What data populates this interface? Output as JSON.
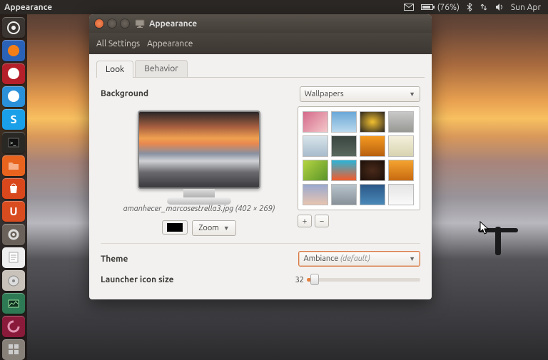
{
  "panel": {
    "app_title": "Appearance",
    "battery": "(76%)",
    "clock": "Sun Apr"
  },
  "launcher": {
    "items": [
      {
        "name": "dash",
        "bg": "#3a3530",
        "inner": "#efefef",
        "shape": "dash"
      },
      {
        "name": "firefox",
        "bg": "#2a62b8",
        "inner": "#f57f17",
        "shape": "circle"
      },
      {
        "name": "opera",
        "bg": "#b41f2a",
        "inner": "#fff",
        "shape": "circle"
      },
      {
        "name": "chromium",
        "bg": "#2a90d9",
        "inner": "#fff",
        "shape": "circle"
      },
      {
        "name": "skype",
        "bg": "#1aa0e8",
        "inner": "#fff",
        "shape": "s"
      },
      {
        "name": "terminal",
        "bg": "#2a2824",
        "inner": "#eee",
        "shape": "term"
      },
      {
        "name": "files",
        "bg": "#e8641e",
        "inner": "#f7b089",
        "shape": "folder"
      },
      {
        "name": "software-center",
        "bg": "#d9481c",
        "inner": "#fff",
        "shape": "bag"
      },
      {
        "name": "ubuntu-one",
        "bg": "#d94c20",
        "inner": "#fff",
        "shape": "u"
      },
      {
        "name": "settings",
        "bg": "#6a625a",
        "inner": "#ddd",
        "shape": "gear"
      },
      {
        "name": "text-editor",
        "bg": "#efefef",
        "inner": "#888",
        "shape": "note"
      },
      {
        "name": "disks",
        "bg": "#c8c2ba",
        "inner": "#555",
        "shape": "disk"
      },
      {
        "name": "system-monitor",
        "bg": "#2e7a55",
        "inner": "#9be2a0",
        "shape": "monitor"
      },
      {
        "name": "devices",
        "bg": "#8a1a3a",
        "inner": "#e294b2",
        "shape": "swirl"
      },
      {
        "name": "workspace",
        "bg": "#878079",
        "inner": "#ccc",
        "shape": "workspace"
      }
    ]
  },
  "window": {
    "title": "Appearance",
    "breadcrumb_root": "All Settings",
    "breadcrumb_current": "Appearance",
    "tabs": {
      "look": "Look",
      "behavior": "Behavior"
    },
    "look": {
      "background_label": "Background",
      "source_dropdown": "Wallpapers",
      "preview_caption": "amanhecer_marcosestrella3.jpg (402 × 269)",
      "zoom_button": "Zoom",
      "theme_label": "Theme",
      "theme_value": "Ambiance",
      "theme_suffix": "(default)",
      "launcher_label": "Launcher icon size",
      "launcher_value": "32",
      "thumbs": [
        "linear-gradient(135deg,#d46a8a,#f4c8ca)",
        "linear-gradient(#6aa8d8,#bad8ec)",
        "radial-gradient(#f2c030,#2a2520)",
        "linear-gradient(#c8c8c8,#989894)",
        "linear-gradient(#d8e4ea,#a8bccc)",
        "linear-gradient(#3a4440,#5a6a60)",
        "linear-gradient(#f49a20,#b86010)",
        "linear-gradient(#f4f0dc,#d8d4b0)",
        "linear-gradient(135deg,#b4d442,#5a9428)",
        "linear-gradient(#2ab4d8,#f45a2a)",
        "radial-gradient(#4a2a1a,#1a0e08)",
        "linear-gradient(#f4a430,#c86a10)",
        "linear-gradient(#9aa8d0,#e8c4b0)",
        "linear-gradient(#b8c4cc,#889098)",
        "linear-gradient(#2a5888,#4a88b8)",
        "linear-gradient(#e4e4e4,#fafafa)"
      ]
    }
  }
}
